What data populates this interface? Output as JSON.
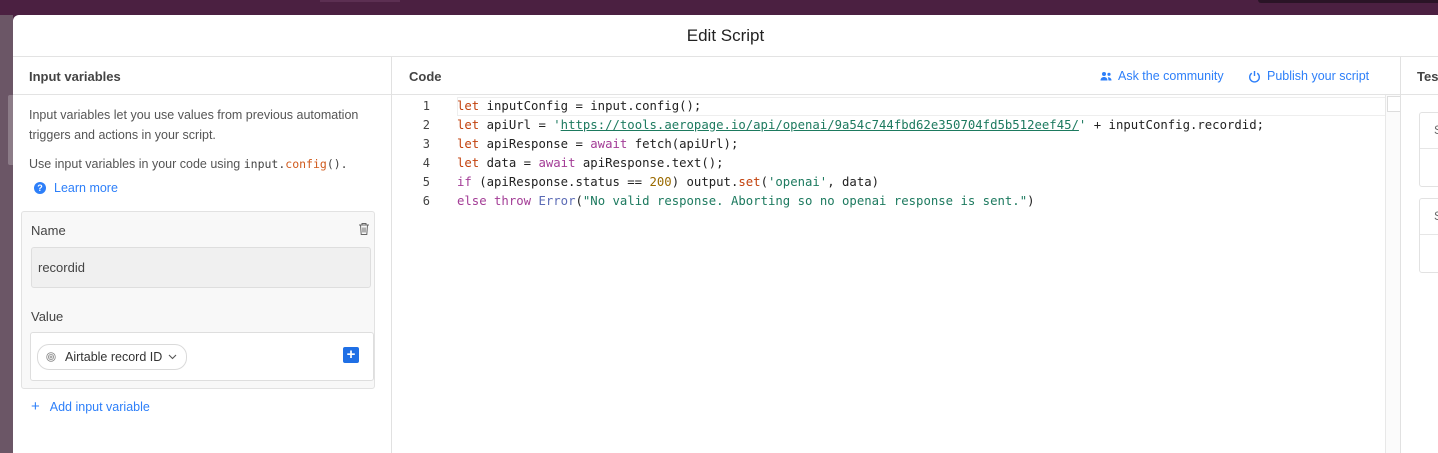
{
  "modal": {
    "title": "Edit Script"
  },
  "input_panel": {
    "heading": "Input variables",
    "help_text": "Input variables let you use values from previous automation triggers and actions in your script.",
    "usage_prefix": "Use input variables in your code using ",
    "usage_code_obj": "input.",
    "usage_code_fn": "config",
    "usage_code_tail": "().",
    "learn_more": "Learn more",
    "variable": {
      "name_label": "Name",
      "name_value": "recordid",
      "value_label": "Value",
      "value_pill": "Airtable record ID"
    },
    "add_label": "Add input variable"
  },
  "code_panel": {
    "heading": "Code",
    "ask_community": "Ask the community",
    "publish": "Publish your script",
    "line_numbers": [
      "1",
      "2",
      "3",
      "4",
      "5",
      "6"
    ]
  },
  "right_panel": {
    "heading": "Tes",
    "card1_letter": "S",
    "card2_letter": "S"
  },
  "code": {
    "l1": {
      "kw": "let",
      "rest": " inputConfig = input.config();"
    },
    "l2": {
      "kw": "let",
      "a": " apiUrl = ",
      "q1": "'",
      "url": "https://tools.aeropage.io/api/openai/9a54c744fbd62e350704fd5b512eef45/",
      "q2": "'",
      "b": " + inputConfig.recordid;"
    },
    "l3": {
      "kw": "let",
      "a": " apiResponse = ",
      "await": "await",
      "b": " fetch(apiUrl);"
    },
    "l4": {
      "kw": "let",
      "a": " data = ",
      "await": "await",
      "b": " apiResponse.text();"
    },
    "l5": {
      "if": "if",
      "a": " (apiResponse.status == ",
      "num": "200",
      "b": ") output.",
      "set": "set",
      "c": "(",
      "str": "'openai'",
      "d": ", data)"
    },
    "l6": {
      "else": "else",
      "sp": " ",
      "throw": "throw",
      "sp2": " ",
      "err": "Error",
      "a": "(",
      "str": "\"No valid response. Aborting so no openai response is sent.\"",
      "b": ")"
    }
  },
  "colors": {
    "accent": "#2d7ff9",
    "brand_bar": "#4b2041",
    "plus_button": "#1f6fe5"
  }
}
